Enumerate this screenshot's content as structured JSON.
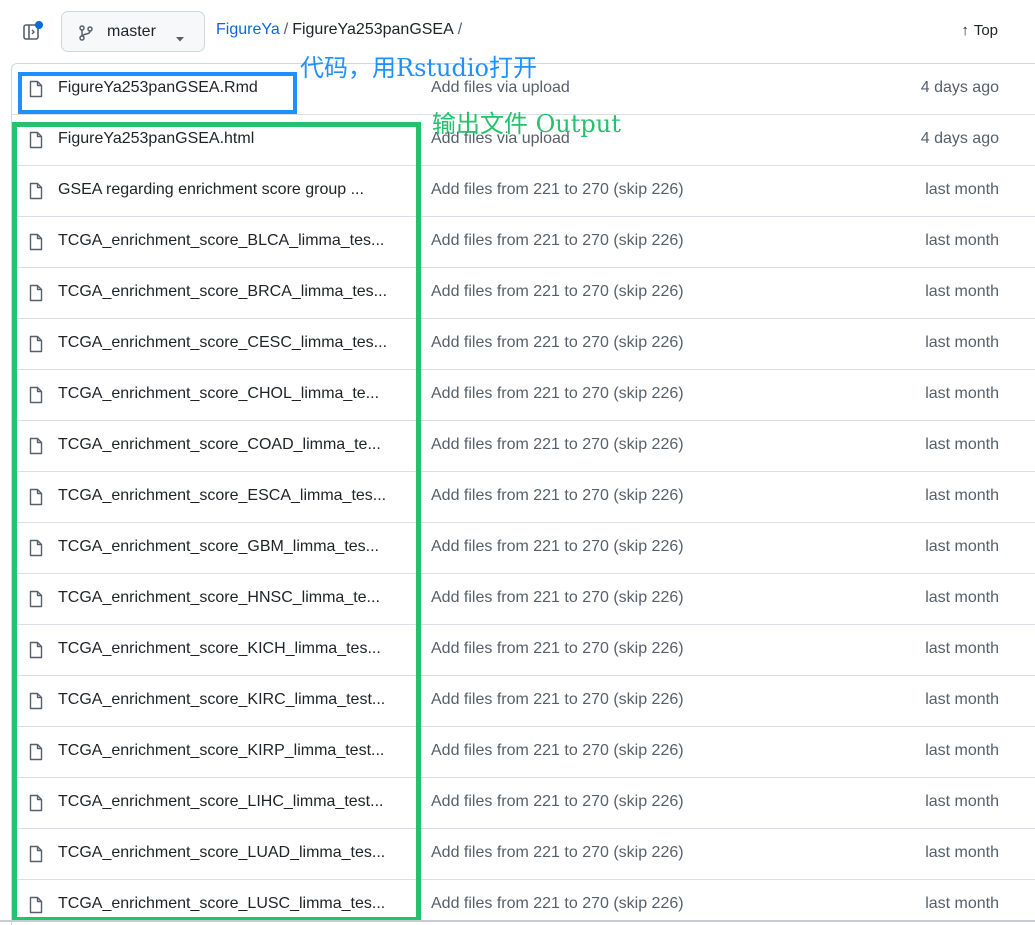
{
  "colors": {
    "link": "#0969da",
    "muted": "#57606a",
    "annotation_blue": "#1e90ff",
    "annotation_green": "#22c36a"
  },
  "header": {
    "sidebar_icon": "sidebar-expand-icon",
    "branch": {
      "icon": "git-branch-icon",
      "label": "master",
      "caret": "▾"
    },
    "breadcrumb": {
      "root": "FigureYa",
      "separator": "/",
      "current": "FigureYa253panGSEA",
      "trailing": "/"
    },
    "top": {
      "arrow": "↑",
      "label": "Top"
    }
  },
  "annotations": {
    "code_label": "代码，用Rstudio打开",
    "output_label": "输出文件 Output"
  },
  "files": [
    {
      "name": "FigureYa253panGSEA.Rmd",
      "message": "Add files via upload",
      "age": "4 days ago"
    },
    {
      "name": "FigureYa253panGSEA.html",
      "message": "Add files via upload",
      "age": "4 days ago"
    },
    {
      "name": "GSEA regarding enrichment score group ...",
      "message": "Add files from 221 to 270 (skip 226)",
      "age": "last month"
    },
    {
      "name": "TCGA_enrichment_score_BLCA_limma_tes...",
      "message": "Add files from 221 to 270 (skip 226)",
      "age": "last month"
    },
    {
      "name": "TCGA_enrichment_score_BRCA_limma_tes...",
      "message": "Add files from 221 to 270 (skip 226)",
      "age": "last month"
    },
    {
      "name": "TCGA_enrichment_score_CESC_limma_tes...",
      "message": "Add files from 221 to 270 (skip 226)",
      "age": "last month"
    },
    {
      "name": "TCGA_enrichment_score_CHOL_limma_te...",
      "message": "Add files from 221 to 270 (skip 226)",
      "age": "last month"
    },
    {
      "name": "TCGA_enrichment_score_COAD_limma_te...",
      "message": "Add files from 221 to 270 (skip 226)",
      "age": "last month"
    },
    {
      "name": "TCGA_enrichment_score_ESCA_limma_tes...",
      "message": "Add files from 221 to 270 (skip 226)",
      "age": "last month"
    },
    {
      "name": "TCGA_enrichment_score_GBM_limma_tes...",
      "message": "Add files from 221 to 270 (skip 226)",
      "age": "last month"
    },
    {
      "name": "TCGA_enrichment_score_HNSC_limma_te...",
      "message": "Add files from 221 to 270 (skip 226)",
      "age": "last month"
    },
    {
      "name": "TCGA_enrichment_score_KICH_limma_tes...",
      "message": "Add files from 221 to 270 (skip 226)",
      "age": "last month"
    },
    {
      "name": "TCGA_enrichment_score_KIRC_limma_test...",
      "message": "Add files from 221 to 270 (skip 226)",
      "age": "last month"
    },
    {
      "name": "TCGA_enrichment_score_KIRP_limma_test...",
      "message": "Add files from 221 to 270 (skip 226)",
      "age": "last month"
    },
    {
      "name": "TCGA_enrichment_score_LIHC_limma_test...",
      "message": "Add files from 221 to 270 (skip 226)",
      "age": "last month"
    },
    {
      "name": "TCGA_enrichment_score_LUAD_limma_tes...",
      "message": "Add files from 221 to 270 (skip 226)",
      "age": "last month"
    },
    {
      "name": "TCGA_enrichment_score_LUSC_limma_tes...",
      "message": "Add files from 221 to 270 (skip 226)",
      "age": "last month"
    }
  ]
}
